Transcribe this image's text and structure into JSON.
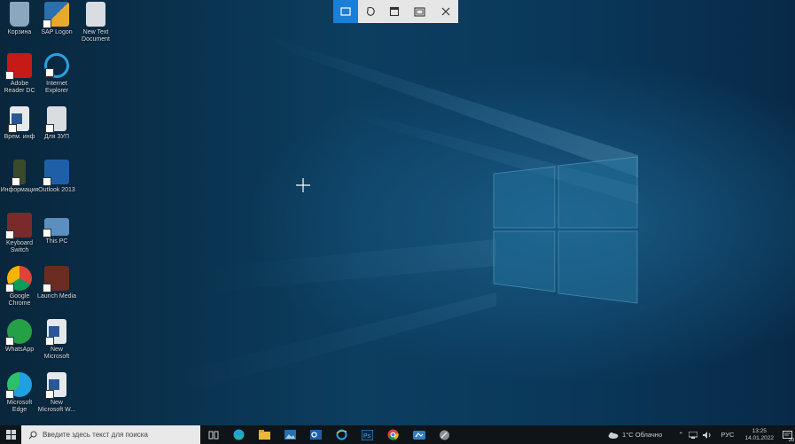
{
  "snip_toolbar": {
    "modes": [
      {
        "name": "rectangular-snip",
        "active": true
      },
      {
        "name": "freeform-snip",
        "active": false
      },
      {
        "name": "window-snip",
        "active": false
      },
      {
        "name": "fullscreen-snip",
        "active": false
      }
    ]
  },
  "desktop_icons": [
    {
      "id": "recycle-bin",
      "label": "Корзина"
    },
    {
      "id": "sap-logon",
      "label": "SAP Logon"
    },
    {
      "id": "new-text-doc",
      "label": "New Text Document"
    },
    {
      "id": "acrobat",
      "label": "Adobe Reader DC"
    },
    {
      "id": "internet-explorer",
      "label": "Internet Explorer"
    },
    {
      "id": "word-doc-1",
      "label": "Врем. инф"
    },
    {
      "id": "file-doc",
      "label": "Для ЗУП"
    },
    {
      "id": "phone-app",
      "label": "Информация"
    },
    {
      "id": "outlook",
      "label": "Outlook 2013"
    },
    {
      "id": "easy-switch",
      "label": "Keyboard Switch"
    },
    {
      "id": "this-pc",
      "label": "This PC"
    },
    {
      "id": "chrome",
      "label": "Google Chrome"
    },
    {
      "id": "launcher",
      "label": "Launch Media"
    },
    {
      "id": "whatsapp",
      "label": "WhatsApp"
    },
    {
      "id": "word-new-1",
      "label": "New Microsoft"
    },
    {
      "id": "edge",
      "label": "Microsoft Edge"
    },
    {
      "id": "word-new-2",
      "label": "New Microsoft W..."
    }
  ],
  "taskbar": {
    "search_placeholder": "Введите здесь текст для поиска",
    "weather": "1°C Облачно",
    "language": "РУС",
    "time": "13:25",
    "date": "14.01.2022",
    "notifications": "20"
  },
  "colors": {
    "snip_accent": "#1a7fd8",
    "taskbar": "#0f1419"
  }
}
